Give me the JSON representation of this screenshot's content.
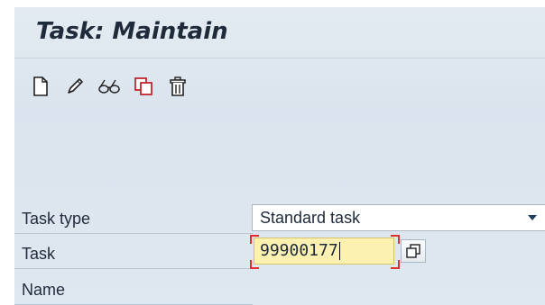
{
  "window": {
    "title": "Task: Maintain"
  },
  "toolbar": {
    "buttons": [
      {
        "name": "create",
        "icon": "new-document-icon"
      },
      {
        "name": "change",
        "icon": "pencil-icon"
      },
      {
        "name": "display",
        "icon": "glasses-icon"
      },
      {
        "name": "copy",
        "icon": "copy-icon"
      },
      {
        "name": "delete",
        "icon": "trash-icon"
      }
    ]
  },
  "form": {
    "task_type": {
      "label": "Task type",
      "value": "Standard task"
    },
    "task": {
      "label": "Task",
      "value": "99900177"
    },
    "name": {
      "label": "Name"
    }
  },
  "colors": {
    "background": "#dfe7f0",
    "required_input_bg": "#fcf1b0",
    "focus_bracket": "#e0312e",
    "text": "#1f2a3a",
    "copy_icon_red": "#c0272d"
  }
}
